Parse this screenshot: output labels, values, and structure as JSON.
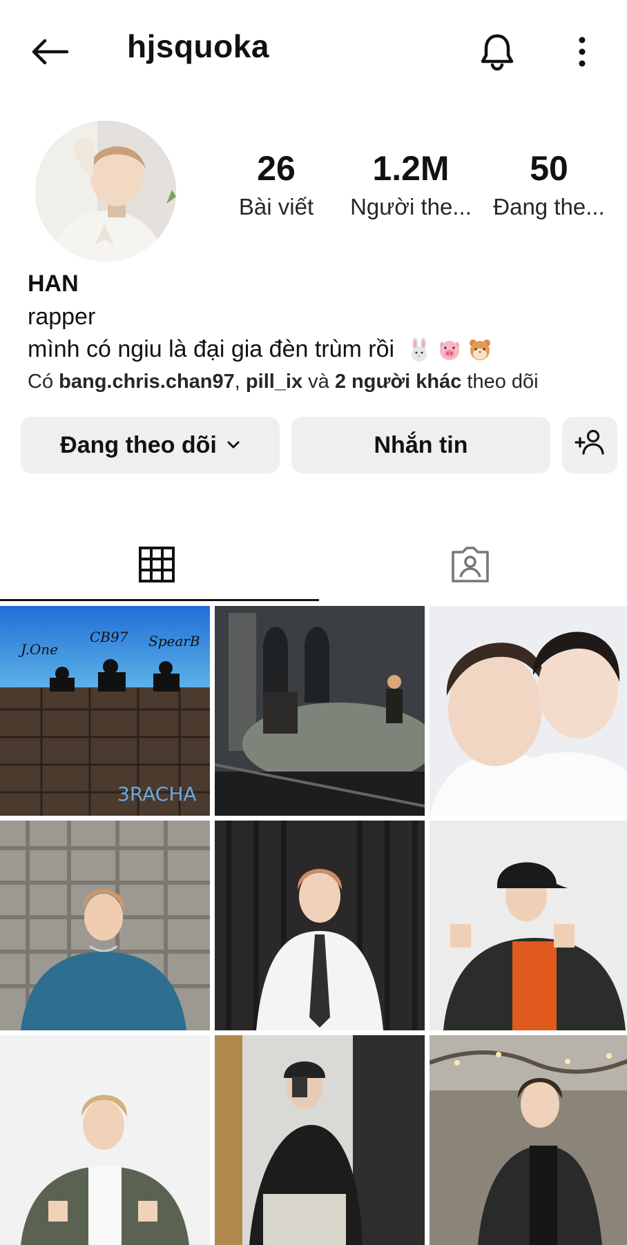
{
  "header": {
    "username": "hjsquoka",
    "back_icon": "back-arrow-icon",
    "bell_icon": "bell-icon",
    "more_icon": "more-vertical-icon"
  },
  "profile": {
    "stats": [
      {
        "value": "26",
        "label": "Bài viết"
      },
      {
        "value": "1.2M",
        "label": "Người the..."
      },
      {
        "value": "50",
        "label": "Đang the..."
      }
    ],
    "name": "HAN",
    "bio_line1": "rapper",
    "bio_line2": "mình có ngiu là đại gia đèn trùm rồi",
    "bio_emojis": [
      "rabbit-face",
      "pig-face",
      "hamster-face"
    ],
    "followed_by": {
      "prefix": "Có ",
      "user1": "bang.chris.chan97",
      "sep": ", ",
      "user2": "pill_ix",
      "and": " và ",
      "others": "2 người khác",
      "suffix": " theo dõi"
    }
  },
  "actions": {
    "following_label": "Đang theo dõi",
    "message_label": "Nhắn tin",
    "add_user_icon": "add-user-icon"
  },
  "tabs": [
    {
      "icon": "grid-icon",
      "active": true
    },
    {
      "icon": "tagged-icon",
      "active": false
    }
  ],
  "posts": [
    {
      "caption_lines": [
        "J.One",
        "CB97",
        "SpearB"
      ],
      "footer": "3RACHA"
    },
    {
      "caption_lines": []
    },
    {
      "caption_lines": []
    },
    {
      "caption_lines": []
    },
    {
      "caption_lines": []
    },
    {
      "caption_lines": []
    },
    {
      "caption_lines": []
    },
    {
      "caption_lines": []
    },
    {
      "caption_lines": []
    }
  ],
  "colors": {
    "button_bg": "#efefef",
    "text": "#111111",
    "tab_active": "#111111"
  }
}
